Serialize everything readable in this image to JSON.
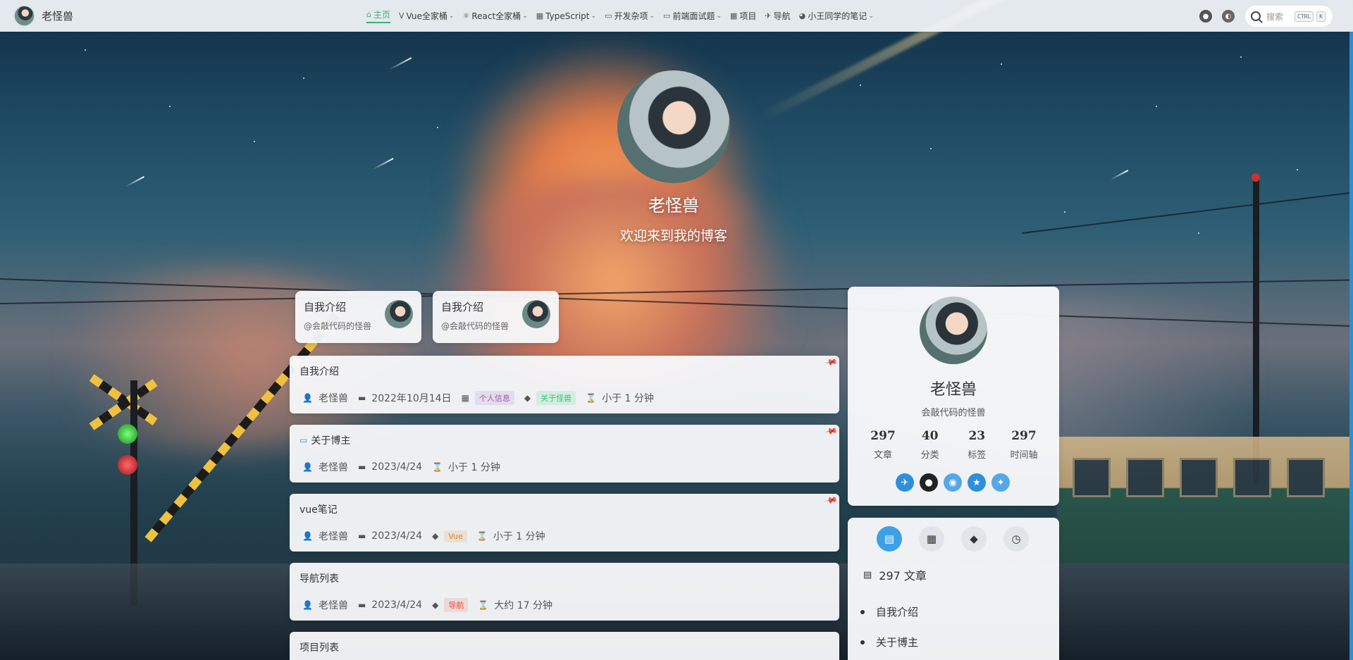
{
  "nav": {
    "brand": "老怪兽",
    "items": [
      {
        "label": "主页",
        "icon": "home-icon",
        "glyph": "⌂",
        "dropdown": false,
        "active": true
      },
      {
        "label": "Vue全家桶",
        "icon": "vue-icon",
        "glyph": "V",
        "dropdown": true,
        "active": false
      },
      {
        "label": "React全家桶",
        "icon": "react-icon",
        "glyph": "⚛",
        "dropdown": true,
        "active": false
      },
      {
        "label": "TypeScript",
        "icon": "typescript-icon",
        "glyph": "▦",
        "dropdown": true,
        "active": false
      },
      {
        "label": "开发杂项",
        "icon": "dev-misc-icon",
        "glyph": "▭",
        "dropdown": true,
        "active": false
      },
      {
        "label": "前端面试题",
        "icon": "interview-icon",
        "glyph": "▭",
        "dropdown": true,
        "active": false
      },
      {
        "label": "项目",
        "icon": "projects-icon",
        "glyph": "▦",
        "dropdown": false,
        "active": false
      },
      {
        "label": "导航",
        "icon": "navigation-icon",
        "glyph": "✈",
        "dropdown": false,
        "active": false
      },
      {
        "label": "小王同学的笔记",
        "icon": "notes-icon",
        "glyph": "◕",
        "dropdown": true,
        "active": false
      }
    ],
    "search": {
      "placeholder": "搜索",
      "key1": "CTRL",
      "key2": "K"
    }
  },
  "hero": {
    "name": "老怪兽",
    "subtitle": "欢迎来到我的博客"
  },
  "pinned_cards": [
    {
      "title": "自我介绍",
      "subtitle": "@会敲代码的怪兽"
    },
    {
      "title": "自我介绍",
      "subtitle": "@会敲代码的怪兽"
    }
  ],
  "articles": [
    {
      "title": "自我介绍",
      "title_icon": "",
      "author": "老怪兽",
      "date": "2022年10月14日",
      "category": "个人信息",
      "tag": "关于怪兽",
      "reading_time": "小于 1 分钟",
      "pinned": true
    },
    {
      "title": "关于博主",
      "title_icon": "presentation-icon",
      "author": "老怪兽",
      "date": "2023/4/24",
      "category": "",
      "tag": "",
      "reading_time": "小于 1 分钟",
      "pinned": true
    },
    {
      "title": "vue笔记",
      "title_icon": "",
      "author": "老怪兽",
      "date": "2023/4/24",
      "category": "",
      "tag": "Vue",
      "reading_time": "小于 1 分钟",
      "pinned": true
    },
    {
      "title": "导航列表",
      "title_icon": "",
      "author": "老怪兽",
      "date": "2023/4/24",
      "category": "",
      "tag": "导航",
      "reading_time": "大约 17 分钟",
      "pinned": false
    },
    {
      "title": "项目列表",
      "title_icon": "",
      "author": "",
      "date": "",
      "category": "",
      "tag": "",
      "reading_time": "",
      "pinned": false
    }
  ],
  "colors": {
    "accent": "#3eaf7c",
    "category_purple": "#9b59b6",
    "tag_green": "#2ecc71",
    "tag_vue_orange": "#e67e22",
    "tag_nav_red": "#e74c3c",
    "pin_blue": "#2a8fe0"
  },
  "profile": {
    "name": "老怪兽",
    "motto": "会敲代码的怪兽",
    "stats": [
      {
        "value": "297",
        "label": "文章"
      },
      {
        "value": "40",
        "label": "分类"
      },
      {
        "value": "23",
        "label": "标签"
      },
      {
        "value": "297",
        "label": "时间轴"
      }
    ],
    "social_icons": [
      "gitee-icon",
      "github-icon",
      "qq-icon",
      "star-icon",
      "twitter-icon"
    ]
  },
  "blog_panel": {
    "tabs": [
      "article-tab-icon",
      "category-tab-icon",
      "tag-tab-icon",
      "timeline-tab-icon"
    ],
    "heading": "297 文章",
    "posts": [
      "自我介绍",
      "关于博主"
    ]
  }
}
